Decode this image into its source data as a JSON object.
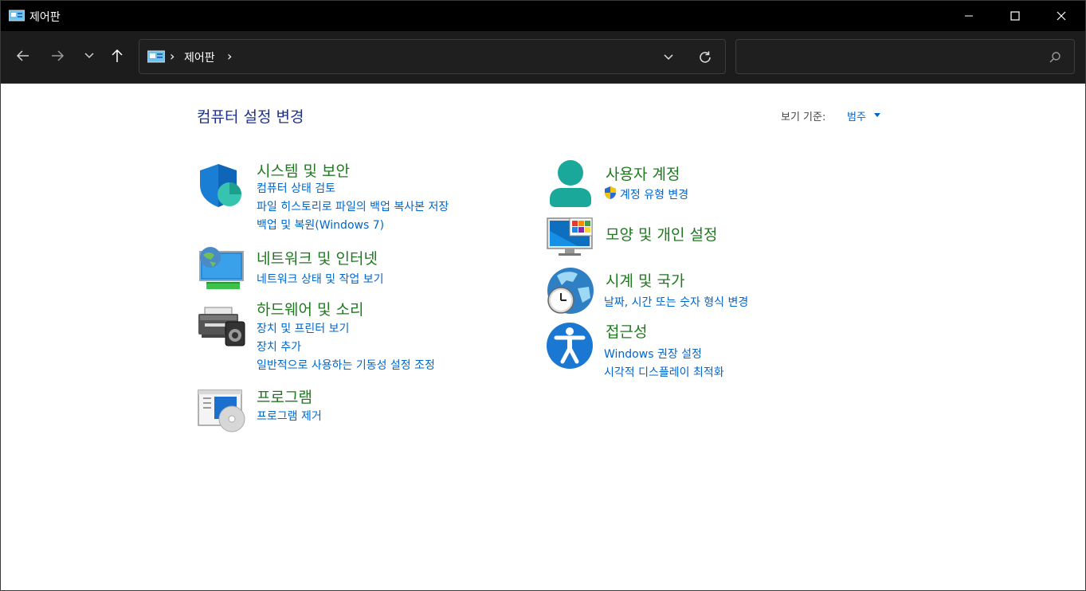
{
  "window": {
    "title": "제어판"
  },
  "address": {
    "crumb": "제어판",
    "separator": "›"
  },
  "search": {
    "placeholder": ""
  },
  "header": {
    "title": "컴퓨터 설정 변경",
    "view_by_label": "보기 기준:",
    "view_by_value": "범주"
  },
  "categories_left": [
    {
      "title": "시스템 및 보안",
      "icon": "shield-icon",
      "links": [
        "컴퓨터 상태 검토",
        "파일 히스토리로 파일의 백업 복사본 저장",
        "백업 및 복원(Windows 7)"
      ]
    },
    {
      "title": "네트워크 및 인터넷",
      "icon": "network-icon",
      "links": [
        "네트워크 상태 및 작업 보기"
      ]
    },
    {
      "title": "하드웨어 및 소리",
      "icon": "printer-icon",
      "links": [
        "장치 및 프린터 보기",
        "장치 추가",
        "일반적으로 사용하는 기동성 설정 조정"
      ]
    },
    {
      "title": "프로그램",
      "icon": "programs-icon",
      "links": [
        "프로그램 제거"
      ]
    }
  ],
  "categories_right": [
    {
      "title": "사용자 계정",
      "icon": "user-icon",
      "links": [
        "계정 유형 변경"
      ]
    },
    {
      "title": "모양 및 개인 설정",
      "icon": "monitor-icon",
      "links": []
    },
    {
      "title": "시계 및 국가",
      "icon": "clock-globe-icon",
      "links": [
        "날짜, 시간 또는 숫자 형식 변경"
      ]
    },
    {
      "title": "접근성",
      "icon": "accessibility-icon",
      "links": [
        "Windows 권장 설정",
        "시각적 디스플레이 최적화"
      ]
    }
  ],
  "colors": {
    "titlebar": "#000000",
    "navbar": "#1c1c1c",
    "link": "#0066cc",
    "category_title": "#1d7a1d",
    "page_title": "#1e3287"
  }
}
